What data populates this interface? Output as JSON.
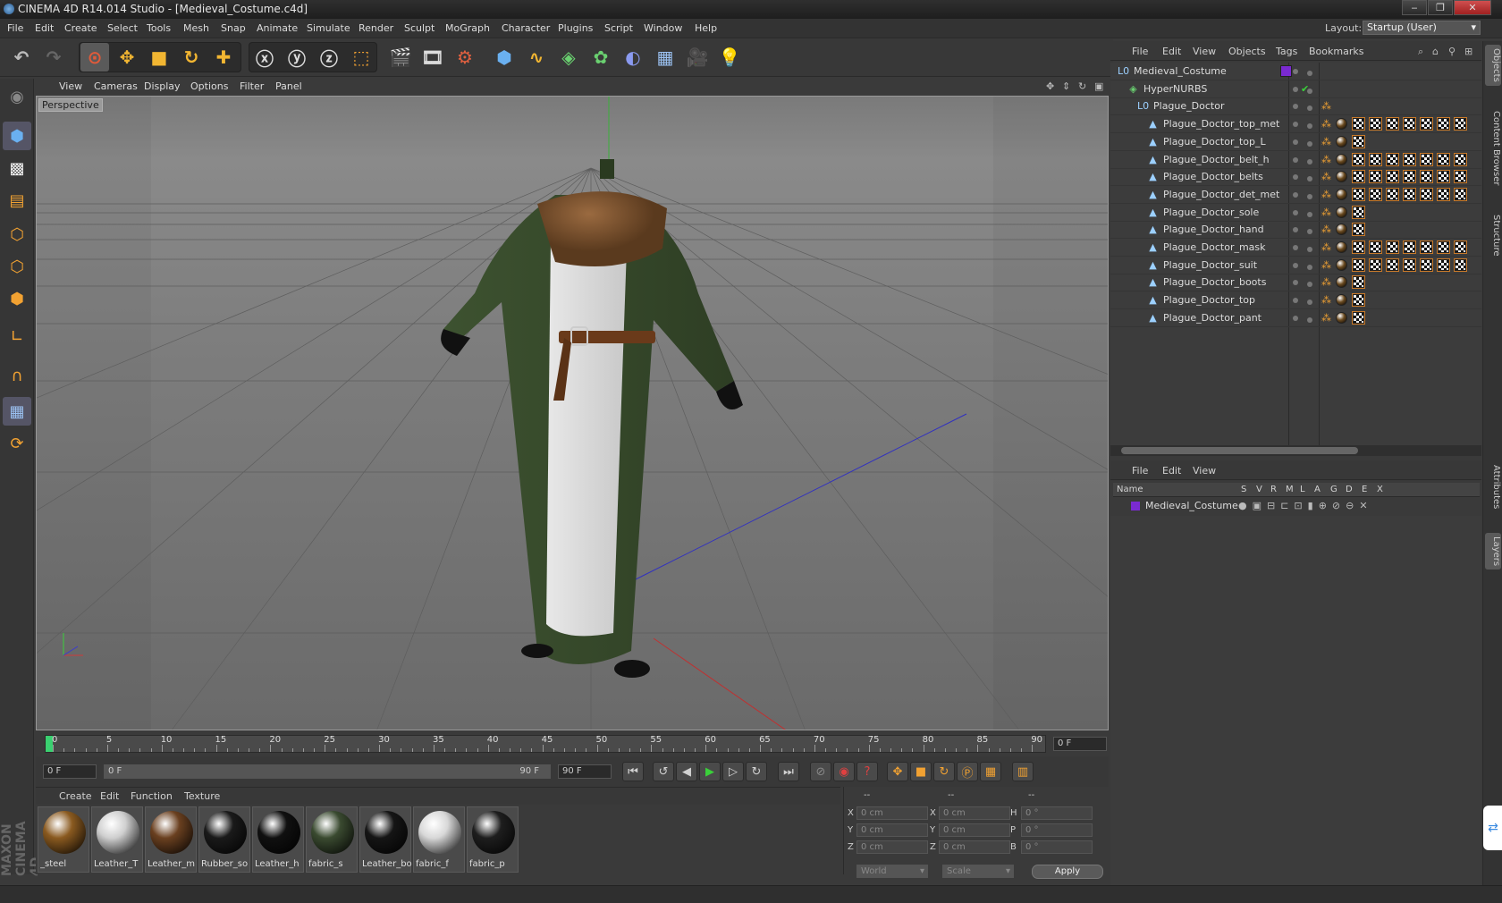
{
  "window": {
    "title": "CINEMA 4D R14.014 Studio - [Medieval_Costume.c4d]",
    "minimize": "‒",
    "maximize": "❐",
    "close": "✕"
  },
  "menu": [
    "File",
    "Edit",
    "Create",
    "Select",
    "Tools",
    "Mesh",
    "Snap",
    "Animate",
    "Simulate",
    "Render",
    "Sculpt",
    "MoGraph",
    "Character",
    "Plugins",
    "Script",
    "Window",
    "Help"
  ],
  "layout": {
    "label": "Layout:",
    "value": "Startup (User)"
  },
  "viewport": {
    "menu": [
      "View",
      "Cameras",
      "Display",
      "Options",
      "Filter",
      "Panel"
    ],
    "label": "Perspective"
  },
  "timeline": {
    "ticks": [
      "0",
      "5",
      "10",
      "15",
      "20",
      "25",
      "30",
      "35",
      "40",
      "45",
      "50",
      "55",
      "60",
      "65",
      "70",
      "75",
      "80",
      "85",
      "90"
    ],
    "current": "0 F",
    "start": "0 F",
    "range_start": "0 F",
    "range_end": "90 F",
    "end": "90 F"
  },
  "materials": {
    "menu": [
      "Create",
      "Edit",
      "Function",
      "Texture"
    ],
    "items": [
      {
        "label": "_steel",
        "color": "#8a5a20"
      },
      {
        "label": "Leather_T",
        "color": "#cfcfcf"
      },
      {
        "label": "Leather_m",
        "color": "#6a4020"
      },
      {
        "label": "Rubber_so",
        "color": "#1a1a1a"
      },
      {
        "label": "Leather_h",
        "color": "#101010"
      },
      {
        "label": "fabric_s",
        "color": "#3a4a30"
      },
      {
        "label": "Leather_bo",
        "color": "#151515"
      },
      {
        "label": "fabric_f",
        "color": "#d8d8d8"
      },
      {
        "label": "fabric_p",
        "color": "#1e1e1e"
      }
    ]
  },
  "coords": {
    "headers": [
      "--",
      "--",
      "--"
    ],
    "rows": [
      {
        "a": "X",
        "av": "0 cm",
        "b": "X",
        "bv": "0 cm",
        "c": "H",
        "cv": "0 °"
      },
      {
        "a": "Y",
        "av": "0 cm",
        "b": "Y",
        "bv": "0 cm",
        "c": "P",
        "cv": "0 °"
      },
      {
        "a": "Z",
        "av": "0 cm",
        "b": "Z",
        "bv": "0 cm",
        "c": "B",
        "cv": "0 °"
      }
    ],
    "mode1": "World",
    "mode2": "Scale",
    "apply": "Apply"
  },
  "objects": {
    "menu": [
      "File",
      "Edit",
      "View",
      "Objects",
      "Tags",
      "Bookmarks"
    ],
    "rows": [
      {
        "name": "Medieval_Costume",
        "indent": 0,
        "icon": "L0",
        "check": "",
        "tags": 0
      },
      {
        "name": "HyperNURBS",
        "indent": 1,
        "icon": "◈",
        "check": "✔",
        "tags": 0
      },
      {
        "name": "Plague_Doctor",
        "indent": 2,
        "icon": "L0",
        "check": "",
        "tags": 0
      },
      {
        "name": "Plague_Doctor_top_met",
        "indent": 3,
        "icon": "▲",
        "check": "",
        "tags": 8
      },
      {
        "name": "Plague_Doctor_top_L",
        "indent": 3,
        "icon": "▲",
        "check": "",
        "tags": 2
      },
      {
        "name": "Plague_Doctor_belt_h",
        "indent": 3,
        "icon": "▲",
        "check": "",
        "tags": 8
      },
      {
        "name": "Plague_Doctor_belts",
        "indent": 3,
        "icon": "▲",
        "check": "",
        "tags": 8
      },
      {
        "name": "Plague_Doctor_det_met",
        "indent": 3,
        "icon": "▲",
        "check": "",
        "tags": 8
      },
      {
        "name": "Plague_Doctor_sole",
        "indent": 3,
        "icon": "▲",
        "check": "",
        "tags": 2
      },
      {
        "name": "Plague_Doctor_hand",
        "indent": 3,
        "icon": "▲",
        "check": "",
        "tags": 2
      },
      {
        "name": "Plague_Doctor_mask",
        "indent": 3,
        "icon": "▲",
        "check": "",
        "tags": 8
      },
      {
        "name": "Plague_Doctor_suit",
        "indent": 3,
        "icon": "▲",
        "check": "",
        "tags": 8
      },
      {
        "name": "Plague_Doctor_boots",
        "indent": 3,
        "icon": "▲",
        "check": "",
        "tags": 2
      },
      {
        "name": "Plague_Doctor_top",
        "indent": 3,
        "icon": "▲",
        "check": "",
        "tags": 2
      },
      {
        "name": "Plague_Doctor_pant",
        "indent": 3,
        "icon": "▲",
        "check": "",
        "tags": 2
      }
    ]
  },
  "layers": {
    "menu": [
      "File",
      "Edit",
      "View"
    ],
    "headers": [
      "Name",
      "S",
      "V",
      "R",
      "M",
      "L",
      "A",
      "G",
      "D",
      "E",
      "X"
    ],
    "row": {
      "name": "Medieval_Costume",
      "color": "#7a2ad0"
    }
  },
  "side_tabs": [
    "Objects",
    "Content Browser",
    "Structure",
    "Attributes",
    "Layers"
  ],
  "brand": "MAXON CINEMA 4D"
}
